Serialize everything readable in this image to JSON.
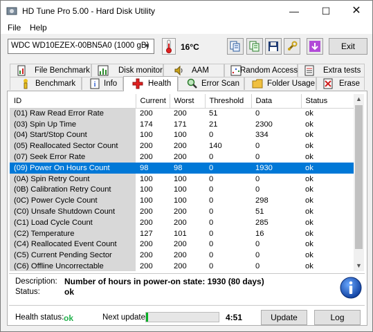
{
  "window": {
    "title": "HD Tune Pro 5.00 - Hard Disk Utility",
    "minimize": "—",
    "maximize": "☐",
    "close": "✕"
  },
  "menu": {
    "file": "File",
    "help": "Help"
  },
  "toolbar": {
    "drive": "WDC WD10EZEX-00BN5A0 (1000 gB)",
    "temperature": "16°C",
    "exit_label": "Exit"
  },
  "tabs_row1": [
    {
      "label": "File Benchmark",
      "icon": "file-benchmark-icon"
    },
    {
      "label": "Disk monitor",
      "icon": "disk-monitor-icon"
    },
    {
      "label": "AAM",
      "icon": "speaker-icon"
    },
    {
      "label": "Random Access",
      "icon": "random-access-icon"
    },
    {
      "label": "Extra tests",
      "icon": "extra-tests-icon"
    }
  ],
  "tabs_row2": [
    {
      "label": "Benchmark",
      "icon": "benchmark-icon"
    },
    {
      "label": "Info",
      "icon": "info-tab-icon"
    },
    {
      "label": "Health",
      "icon": "health-cross-icon"
    },
    {
      "label": "Error Scan",
      "icon": "magnifier-icon"
    },
    {
      "label": "Folder Usage",
      "icon": "folder-icon"
    },
    {
      "label": "Erase",
      "icon": "erase-icon"
    }
  ],
  "table": {
    "columns": [
      "ID",
      "Current",
      "Worst",
      "Threshold",
      "Data",
      "Status"
    ],
    "rows": [
      [
        "(01) Raw Read Error Rate",
        "200",
        "200",
        "51",
        "0",
        "ok"
      ],
      [
        "(03) Spin Up Time",
        "174",
        "171",
        "21",
        "2300",
        "ok"
      ],
      [
        "(04) Start/Stop Count",
        "100",
        "100",
        "0",
        "334",
        "ok"
      ],
      [
        "(05) Reallocated Sector Count",
        "200",
        "200",
        "140",
        "0",
        "ok"
      ],
      [
        "(07) Seek Error Rate",
        "200",
        "200",
        "0",
        "0",
        "ok"
      ],
      [
        "(09) Power On Hours Count",
        "98",
        "98",
        "0",
        "1930",
        "ok"
      ],
      [
        "(0A) Spin Retry Count",
        "100",
        "100",
        "0",
        "0",
        "ok"
      ],
      [
        "(0B) Calibration Retry Count",
        "100",
        "100",
        "0",
        "0",
        "ok"
      ],
      [
        "(0C) Power Cycle Count",
        "100",
        "100",
        "0",
        "298",
        "ok"
      ],
      [
        "(C0) Unsafe Shutdown Count",
        "200",
        "200",
        "0",
        "51",
        "ok"
      ],
      [
        "(C1) Load Cycle Count",
        "200",
        "200",
        "0",
        "285",
        "ok"
      ],
      [
        "(C2) Temperature",
        "127",
        "101",
        "0",
        "16",
        "ok"
      ],
      [
        "(C4) Reallocated Event Count",
        "200",
        "200",
        "0",
        "0",
        "ok"
      ],
      [
        "(C5) Current Pending Sector",
        "200",
        "200",
        "0",
        "0",
        "ok"
      ],
      [
        "(C6) Offline Uncorrectable",
        "200",
        "200",
        "0",
        "0",
        "ok"
      ]
    ],
    "selected_row": 5
  },
  "details": {
    "description_label": "Description:",
    "description": "Number of hours in power-on state: 1930 (80 days)",
    "status_label": "Status:",
    "status": "ok"
  },
  "footer": {
    "health_label": "Health status:",
    "health": "ok",
    "next_update_label": "Next update:",
    "progress": 0.03,
    "time": "4:51",
    "update_label": "Update",
    "log_label": "Log"
  },
  "colors": {
    "selection": "#0078d7",
    "health_ok": "#22b14c",
    "progress": "#06b025"
  }
}
